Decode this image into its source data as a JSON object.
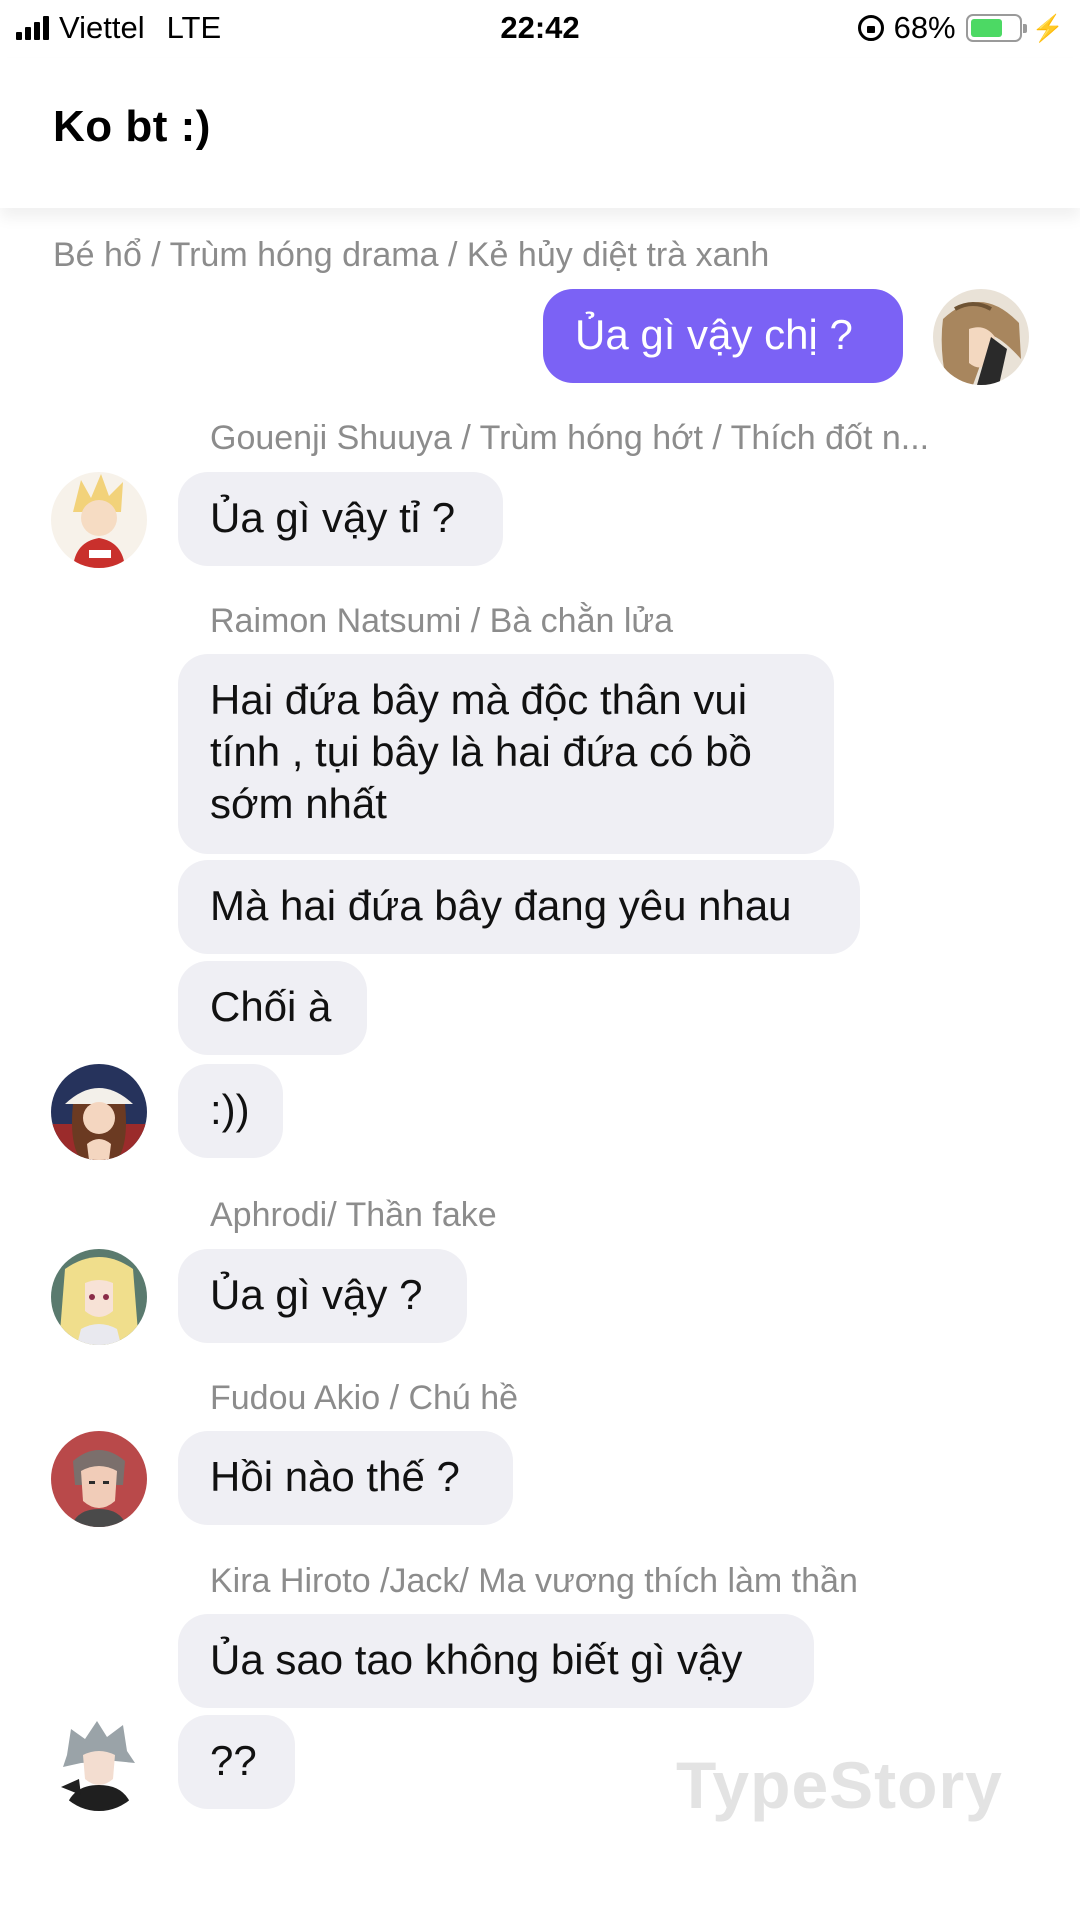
{
  "status_bar": {
    "carrier": "Viettel",
    "network": "LTE",
    "time": "22:42",
    "battery_percent_text": "68%",
    "battery_level": 0.68,
    "battery_color": "#4cd964"
  },
  "header": {
    "title": "Ko bt :)"
  },
  "messages": {
    "m1": {
      "sender": "Bé hổ / Trùm hóng drama / Kẻ hủy diệt trà xanh",
      "text": "Ủa gì vậy chị ?"
    },
    "m2": {
      "sender": "Gouenji Shuuya / Trùm hóng hớt / Thích đốt n...",
      "text": "Ủa gì vậy tỉ ?"
    },
    "m3": {
      "sender": "Raimon Natsumi / Bà chằn lửa",
      "text1": "Hai đứa bây mà độc thân vui tính  , tụi bây là hai đứa có bồ sớm nhất",
      "text2": "Mà hai đứa bây đang yêu nhau",
      "text3": "Chối à",
      "text4": ":))"
    },
    "m4": {
      "sender": "Aphrodi/ Thần fake",
      "text": "Ủa gì vậy ?"
    },
    "m5": {
      "sender": "Fudou Akio / Chú hề",
      "text": "Hồi nào thế ?"
    },
    "m6": {
      "sender": "Kira Hiroto /Jack/ Ma vương thích làm thần",
      "text1": "Ủa sao tao không biết gì vậy",
      "text2": "??"
    }
  },
  "watermark": "TypeStory",
  "colors": {
    "my_bubble": "#7b62f5",
    "other_bubble": "#efeff4",
    "sender_name": "#8c8c8c"
  }
}
